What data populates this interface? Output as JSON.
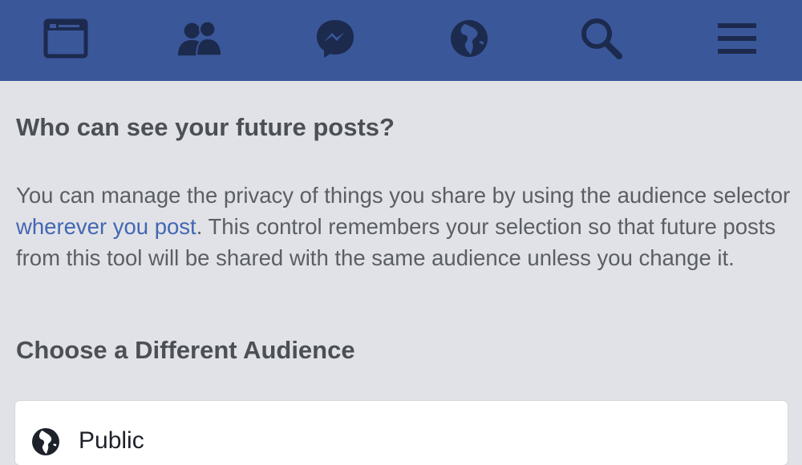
{
  "nav": {
    "items": [
      {
        "icon": "news-feed-icon"
      },
      {
        "icon": "friends-icon"
      },
      {
        "icon": "messenger-icon"
      },
      {
        "icon": "globe-notifications-icon"
      },
      {
        "icon": "search-icon"
      },
      {
        "icon": "menu-icon"
      }
    ],
    "colors": {
      "bar": "#3a579a",
      "icon": "#1c2a4d"
    }
  },
  "section": {
    "title": "Who can see your future posts?",
    "description_part1": "You can manage the privacy of things you share by using the audience selector ",
    "description_link": "wherever you post",
    "description_part2": ". This control remembers your selection so that future posts from this tool will be shared with the same audience unless you change it."
  },
  "audience": {
    "heading": "Choose a Different Audience",
    "options": [
      {
        "label": "Public",
        "icon": "globe-icon"
      }
    ]
  }
}
